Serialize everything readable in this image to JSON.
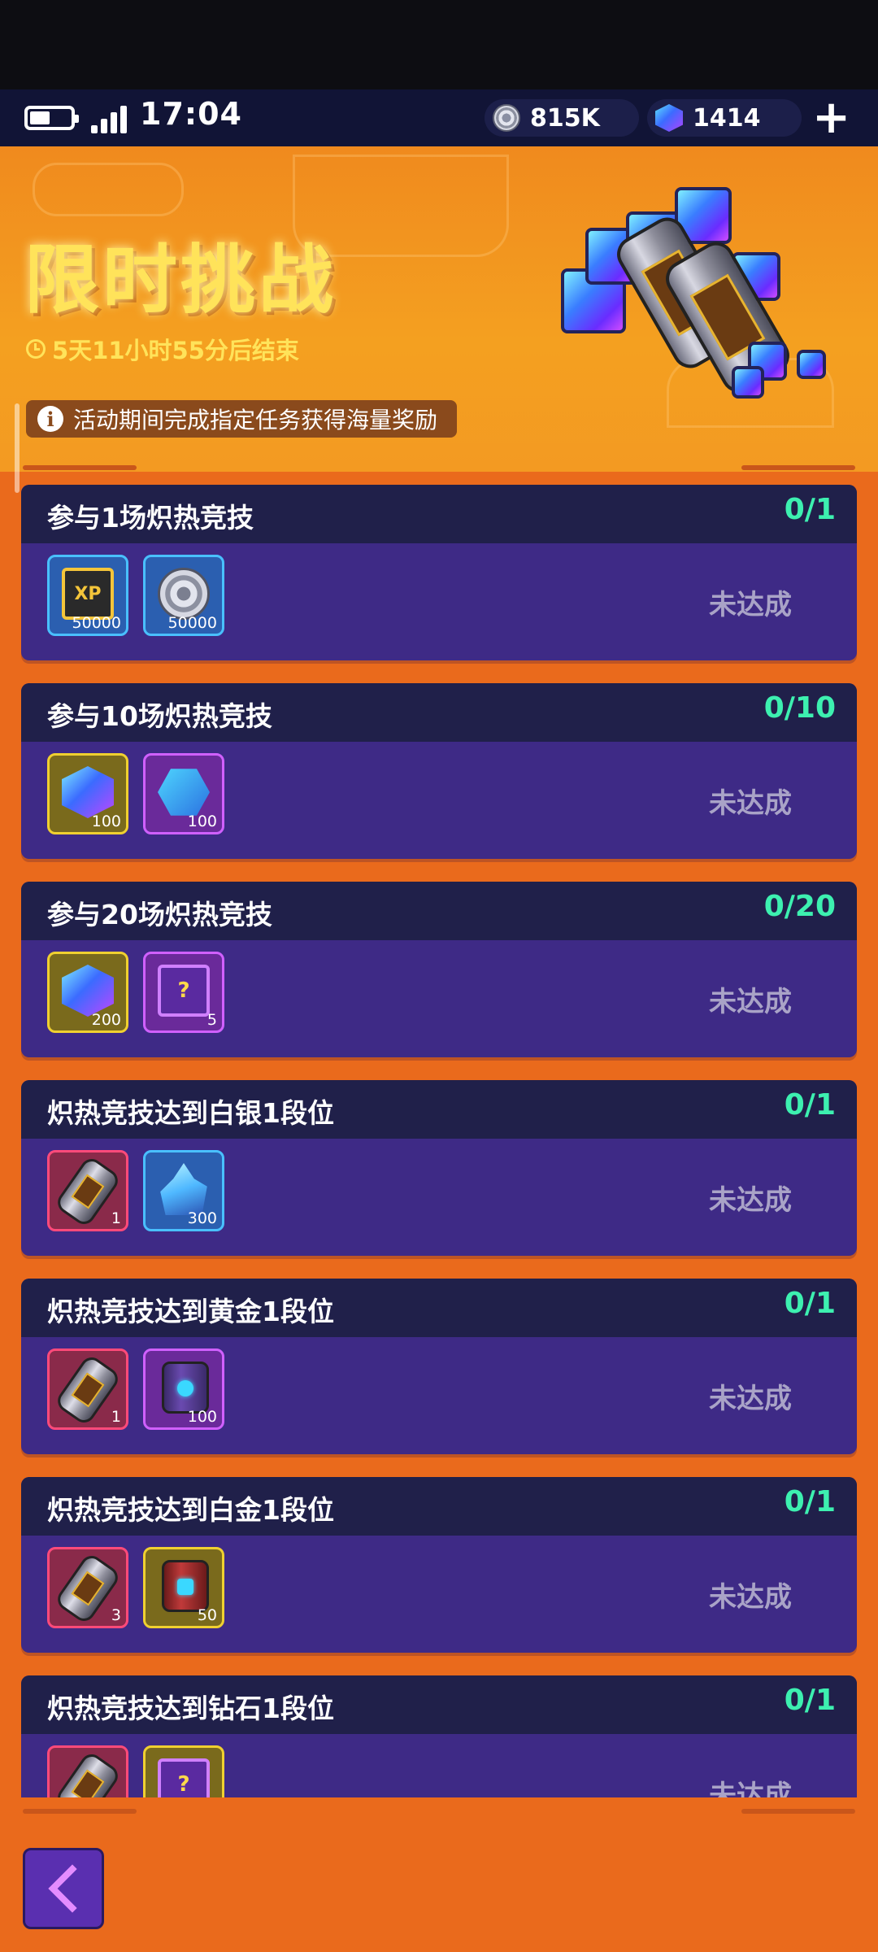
{
  "status_bar": {
    "time": "17:04",
    "coins": "815K",
    "gems": "1414",
    "add_label": "+"
  },
  "header": {
    "title": "限时挑战",
    "timer": "5天11小时55分后结束",
    "notice": "活动期间完成指定任务获得海量奖励",
    "info_icon_glyph": "i"
  },
  "tasks": [
    {
      "title": "参与1场炽热竞技",
      "progress": "0/1",
      "status": "未达成",
      "rewards": [
        {
          "icon": "xp-chip-icon",
          "count": "50000",
          "frame": "blue",
          "label": "XP"
        },
        {
          "icon": "coin-icon",
          "count": "50000",
          "frame": "blue"
        }
      ]
    },
    {
      "title": "参与10场炽热竞技",
      "progress": "0/10",
      "status": "未达成",
      "rewards": [
        {
          "icon": "gem-cube-icon",
          "count": "100",
          "frame": "gold"
        },
        {
          "icon": "hex-token-icon",
          "count": "100",
          "frame": "purple"
        }
      ]
    },
    {
      "title": "参与20场炽热竞技",
      "progress": "0/20",
      "status": "未达成",
      "rewards": [
        {
          "icon": "gem-cube-icon",
          "count": "200",
          "frame": "gold"
        },
        {
          "icon": "mystery-chest-icon",
          "count": "5",
          "frame": "purple",
          "label": "?"
        }
      ]
    },
    {
      "title": "炽热竞技达到白银1段位",
      "progress": "0/1",
      "status": "未达成",
      "rewards": [
        {
          "icon": "capsule-icon",
          "count": "1",
          "frame": "red"
        },
        {
          "icon": "crystal-icon",
          "count": "300",
          "frame": "blue"
        }
      ]
    },
    {
      "title": "炽热竞技达到黄金1段位",
      "progress": "0/1",
      "status": "未达成",
      "rewards": [
        {
          "icon": "capsule-icon",
          "count": "1",
          "frame": "red"
        },
        {
          "icon": "energy-barrel-icon",
          "count": "100",
          "frame": "purple"
        }
      ]
    },
    {
      "title": "炽热竞技达到白金1段位",
      "progress": "0/1",
      "status": "未达成",
      "rewards": [
        {
          "icon": "capsule-icon",
          "count": "3",
          "frame": "red"
        },
        {
          "icon": "red-barrel-icon",
          "count": "50",
          "frame": "gold"
        }
      ]
    },
    {
      "title": "炽热竞技达到钻石1段位",
      "progress": "0/1",
      "status": "未达成",
      "rewards": [
        {
          "icon": "capsule-icon",
          "count": "",
          "frame": "red"
        },
        {
          "icon": "mystery-chest-icon",
          "count": "",
          "frame": "gold",
          "label": "?"
        }
      ]
    }
  ],
  "colors": {
    "progress": "#3df0b0",
    "title_yellow": "#ffe35a",
    "card_bg": "#3e2a86",
    "card_head": "#20204a",
    "page_orange": "#ea6a1c"
  },
  "nav": {
    "back_icon": "chevron-left-icon"
  }
}
